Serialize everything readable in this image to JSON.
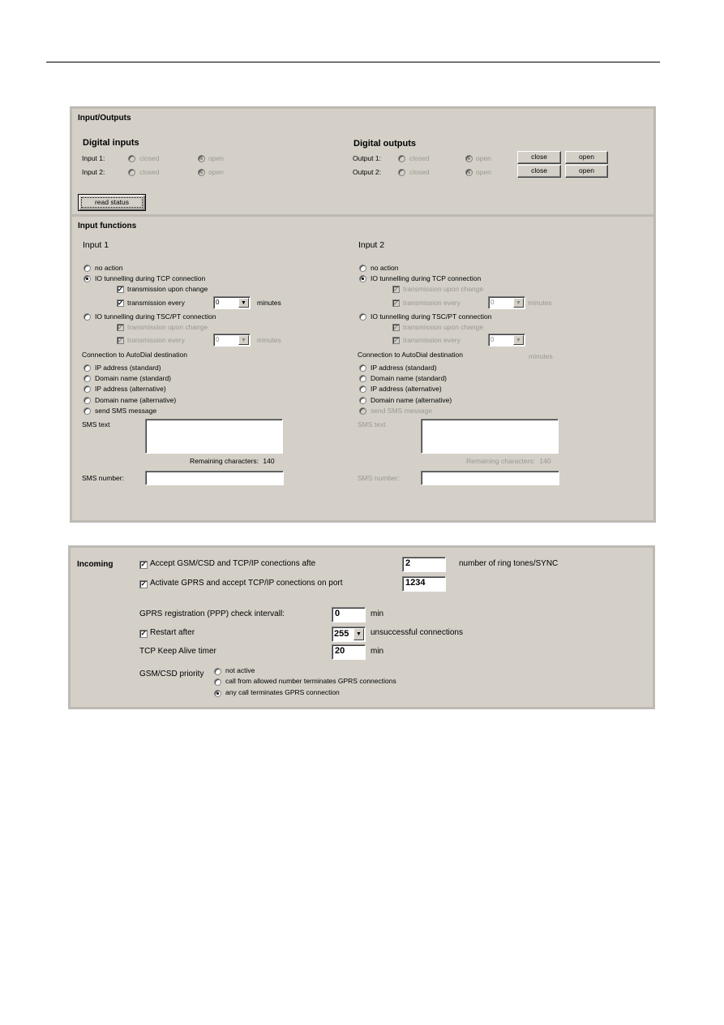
{
  "io_panel": {
    "title": "Input/Outputs",
    "digital_inputs": {
      "heading": "Digital inputs",
      "rows": [
        {
          "label": "Input 1:",
          "closed": "closed",
          "open": "open",
          "state": "open"
        },
        {
          "label": "Input 2:",
          "closed": "closed",
          "open": "open",
          "state": "open"
        }
      ]
    },
    "digital_outputs": {
      "heading": "Digital outputs",
      "rows": [
        {
          "label": "Output 1:",
          "closed": "closed",
          "open": "open",
          "state": "open",
          "close_btn": "close",
          "open_btn": "open"
        },
        {
          "label": "Output 2:",
          "closed": "closed",
          "open": "open",
          "state": "open",
          "close_btn": "close",
          "open_btn": "open"
        }
      ]
    },
    "read_status_label": "read status"
  },
  "input_functions": {
    "title": "Input functions",
    "inputs": [
      {
        "heading": "Input 1",
        "no_action": "no action",
        "tcp": "IO tunnelling during TCP connection",
        "tcp_upon_change": "transmission upon change",
        "tcp_every": "transmission every",
        "tcp_every_value": "0",
        "tcp_minutes": "minutes",
        "tsc": "IO tunnelling during TSC/PT connection",
        "tsc_upon_change": "transmission upon change",
        "tsc_every": "transmission every",
        "tsc_every_value": "0",
        "tsc_minutes": "minutes",
        "autodial_label": "Connection to AutoDial destination",
        "dest_options": [
          "IP address (standard)",
          "Domain name (standard)",
          "IP address (alternative)",
          "Domain name (alternative)",
          "send SMS message"
        ],
        "sms_text_label": "SMS text",
        "sms_text_value": "",
        "remaining_label": "Remaining characters:",
        "remaining_value": "140",
        "sms_number_label": "SMS number:",
        "sms_number_value": ""
      },
      {
        "heading": "Input 2",
        "no_action": "no action",
        "tcp": "IO tunnelling during TCP connection",
        "tcp_upon_change": "transmission upon change",
        "tcp_every": "transmission every",
        "tcp_every_value": "0",
        "tcp_minutes": "minutes",
        "tsc": "IO tunnelling during TSC/PT connection",
        "tsc_upon_change": "transmission upon change",
        "tsc_every": "transmission every",
        "tsc_every_value": "0",
        "tsc_minutes": "minutes",
        "autodial_label": "Connection to AutoDial destination",
        "dest_options": [
          "IP address (standard)",
          "Domain name (standard)",
          "IP address (alternative)",
          "Domain name (alternative)",
          "send SMS message"
        ],
        "sms_text_label": "SMS text",
        "sms_text_value": "",
        "remaining_label": "Remaining characters:",
        "remaining_value": "140",
        "sms_number_label": "SMS number:",
        "sms_number_value": ""
      }
    ]
  },
  "incoming": {
    "title": "Incoming",
    "accept_gsm_label": "Accept GSM/CSD and TCP/IP conections afte",
    "accept_gsm_checked": true,
    "ring_tones_value": "2",
    "ring_tones_label": "number of ring tones/SYNC",
    "activate_gprs_label": "Activate GPRS and accept TCP/IP conections on port",
    "activate_gprs_checked": true,
    "port_value": "1234",
    "ppp_check_label": "GPRS registration (PPP) check intervall:",
    "ppp_check_value": "0",
    "ppp_unit": "min",
    "restart_label": "Restart after",
    "restart_checked": true,
    "restart_value": "255",
    "restart_unit": "unsuccessful connections",
    "keepalive_label": "TCP Keep Alive timer",
    "keepalive_value": "20",
    "keepalive_unit": "min",
    "priority_label": "GSM/CSD priority",
    "priority_options": [
      "not active",
      "call from allowed number terminates GPRS connections",
      "any call terminates GPRS connection"
    ],
    "priority_selected": 2
  },
  "glyphs": {
    "check": "✓",
    "arrow": "▼"
  }
}
